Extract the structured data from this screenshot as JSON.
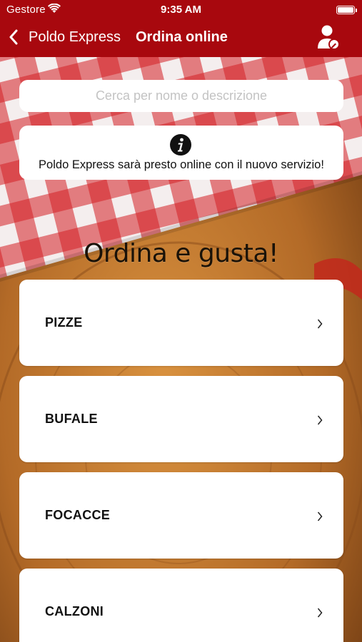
{
  "status_bar": {
    "carrier": "Gestore",
    "time": "9:35 AM"
  },
  "nav": {
    "back_label": "Poldo Express",
    "title": "Ordina online",
    "user_icon": "user-edit-icon"
  },
  "search": {
    "placeholder": "Cerca per nome o descrizione",
    "value": ""
  },
  "notice": {
    "icon": "info-icon",
    "text": "Poldo Express sarà presto online con il nuovo servizio!"
  },
  "headline": "Ordina e gusta!",
  "categories": [
    {
      "label": "PIZZE"
    },
    {
      "label": "BUFALE"
    },
    {
      "label": "FOCACCE"
    },
    {
      "label": "CALZONI"
    }
  ],
  "colors": {
    "header": "#a8080e",
    "tablecloth_red": "#c8151b",
    "wood": "#b36a27"
  }
}
